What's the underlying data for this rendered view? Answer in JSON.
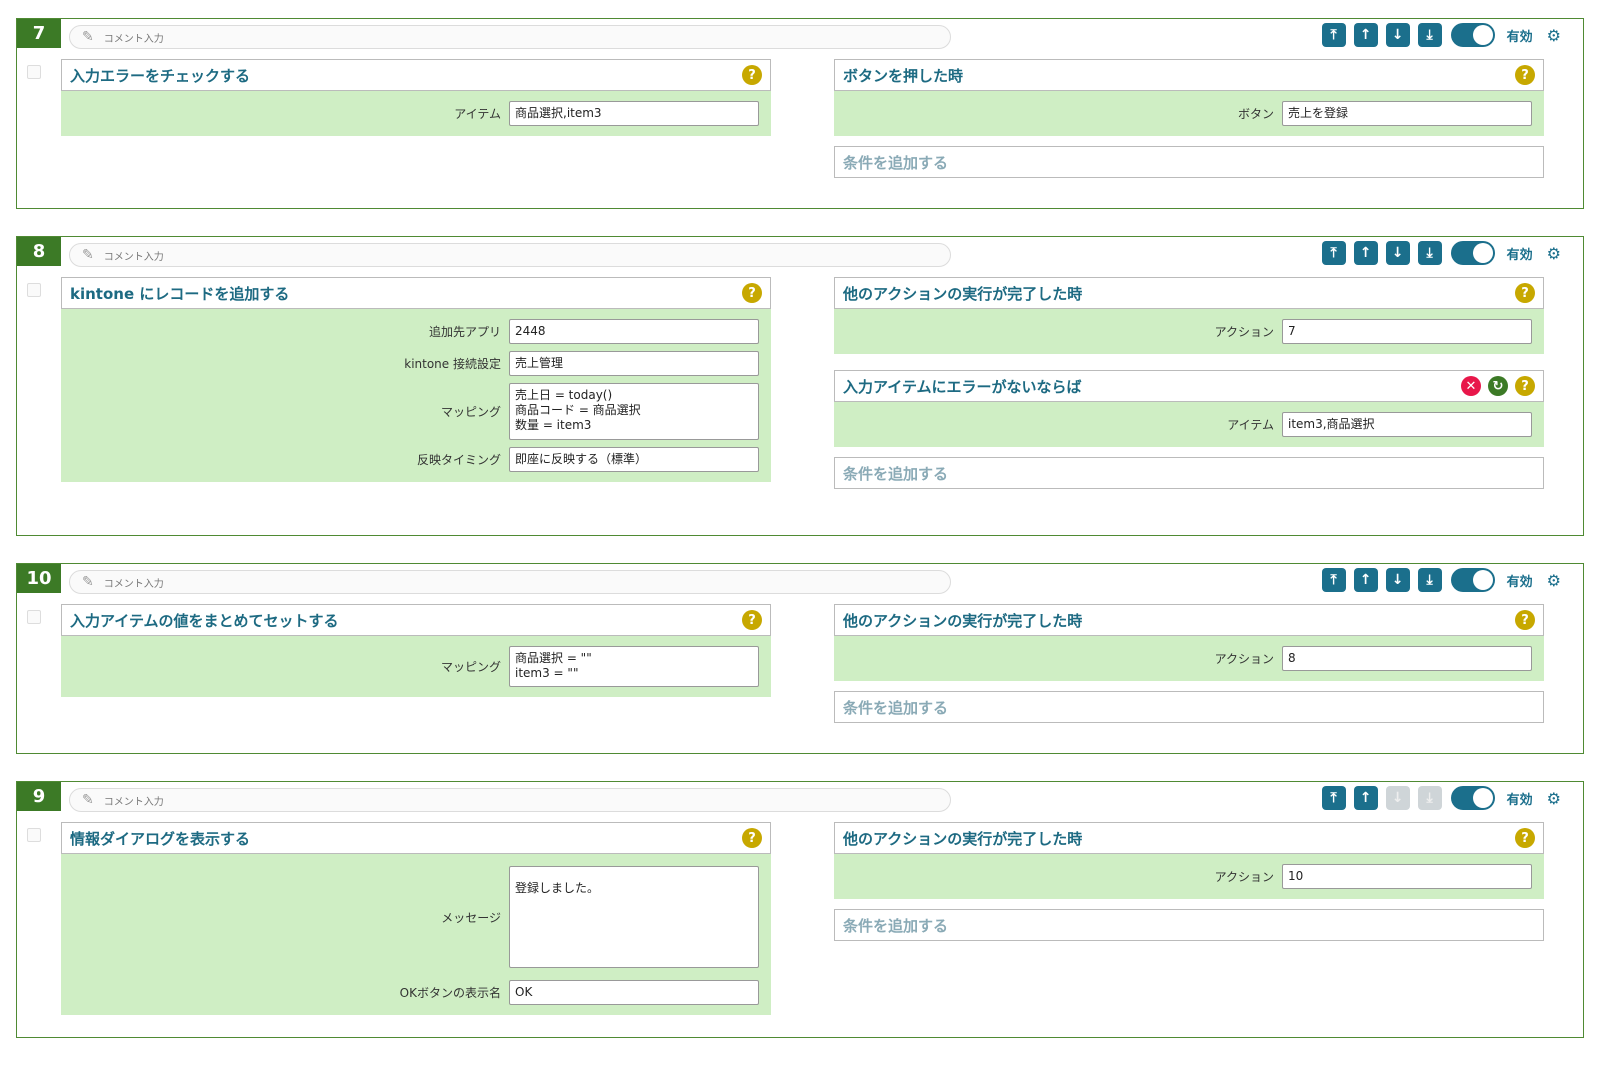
{
  "common": {
    "comment_placeholder": "コメント入力",
    "enabled_label": "有効",
    "add_condition": "条件を追加する"
  },
  "blocks": [
    {
      "number": "7",
      "action": {
        "title": "入力エラーをチェックする",
        "fields": [
          {
            "label": "アイテム",
            "value": "商品選択,item3"
          }
        ]
      },
      "conditions": [
        {
          "title": "ボタンを押した時",
          "fields": [
            {
              "label": "ボタン",
              "value": "売上を登録"
            }
          ]
        }
      ],
      "move_down_enabled": true
    },
    {
      "number": "8",
      "action": {
        "title": "kintone にレコードを追加する",
        "fields": [
          {
            "label": "追加先アプリ",
            "value": "2448"
          },
          {
            "label": "kintone 接続設定",
            "value": "売上管理"
          },
          {
            "label": "マッピング",
            "value": "売上日 = today()\n商品コード = 商品選択\n数量 = item3"
          },
          {
            "label": "反映タイミング",
            "value": "即座に反映する（標準）"
          }
        ]
      },
      "conditions": [
        {
          "title": "他のアクションの実行が完了した時",
          "fields": [
            {
              "label": "アクション",
              "value": "7"
            }
          ]
        },
        {
          "title": "入力アイテムにエラーがないならば",
          "fields": [
            {
              "label": "アイテム",
              "value": "item3,商品選択"
            }
          ]
        }
      ],
      "move_down_enabled": true
    },
    {
      "number": "10",
      "action": {
        "title": "入力アイテムの値をまとめてセットする",
        "fields": [
          {
            "label": "マッピング",
            "value": "商品選択 = \"\"\nitem3 = \"\""
          }
        ]
      },
      "conditions": [
        {
          "title": "他のアクションの実行が完了した時",
          "fields": [
            {
              "label": "アクション",
              "value": "8"
            }
          ]
        }
      ],
      "move_down_enabled": true
    },
    {
      "number": "9",
      "action": {
        "title": "情報ダイアログを表示する",
        "fields": [
          {
            "label": "メッセージ",
            "value": "登録しました。"
          },
          {
            "label": "OKボタンの表示名",
            "value": "OK"
          }
        ]
      },
      "conditions": [
        {
          "title": "他のアクションの実行が完了した時",
          "fields": [
            {
              "label": "アクション",
              "value": "10"
            }
          ]
        }
      ],
      "move_down_enabled": false
    }
  ],
  "colors": {
    "accent": "#1b6f8c",
    "block_border": "#4f8a33",
    "number_bg": "#3c7a26",
    "field_bg": "#cfeec4",
    "help_icon": "#c7a800",
    "delete_icon": "#e8174a"
  }
}
